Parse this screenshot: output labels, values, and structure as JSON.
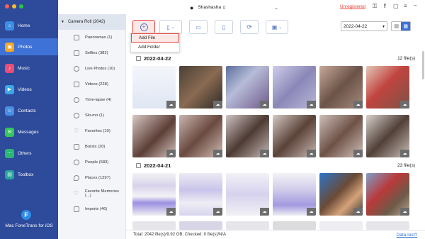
{
  "app": {
    "name": "Mac FoneTrans for iOS"
  },
  "nav": {
    "items": [
      {
        "label": "Home",
        "color": "#3a8ee6",
        "icon": "home-icon"
      },
      {
        "label": "Photos",
        "color": "#f5a623",
        "icon": "photos-icon",
        "active": true
      },
      {
        "label": "Music",
        "color": "#e94e77",
        "icon": "music-icon"
      },
      {
        "label": "Videos",
        "color": "#3aa7e6",
        "icon": "videos-icon"
      },
      {
        "label": "Contacts",
        "color": "#4a90e2",
        "icon": "contacts-icon"
      },
      {
        "label": "Messages",
        "color": "#34c759",
        "icon": "messages-icon"
      },
      {
        "label": "Others",
        "color": "#2bb673",
        "icon": "others-icon"
      },
      {
        "label": "Toolbox",
        "color": "#26a69a",
        "icon": "toolbox-icon"
      }
    ]
  },
  "device": {
    "name": "Shashasha"
  },
  "top_links": {
    "unregistered": "Unregistered"
  },
  "sidebar": {
    "header": "Camera Roll (2042)",
    "albums": [
      {
        "label": "Panoramas (1)"
      },
      {
        "label": "Selfies (382)"
      },
      {
        "label": "Live Photos (10)"
      },
      {
        "label": "Videos (228)"
      },
      {
        "label": "Time-lapse (4)"
      },
      {
        "label": "Slo-mo (1)"
      },
      {
        "label": "Favorites (10)"
      },
      {
        "label": "Bursts (20)"
      },
      {
        "label": "People (683)"
      },
      {
        "label": "Places (1297)"
      },
      {
        "label": "Favorite Memories (...)"
      },
      {
        "label": "Imports (46)"
      }
    ]
  },
  "toolbar": {
    "add_menu": {
      "items": [
        "Add File",
        "Add Folder"
      ]
    },
    "date_filter": "2022-04-22"
  },
  "groups": [
    {
      "date": "2022-04-22",
      "count": "12 file(s)"
    },
    {
      "date": "2022-04-21",
      "count": "23 file(s)"
    }
  ],
  "footer": {
    "status": "Total: 2042 file(s)/9.92 GB; Checked: 0 file(s)/N/A",
    "data_lost": "Data lost?"
  },
  "colors": {
    "nav_bg": "#2d4a9b",
    "nav_active": "#3e72d6",
    "accent_red": "#e8493f",
    "link_blue": "#2a6ed0"
  }
}
